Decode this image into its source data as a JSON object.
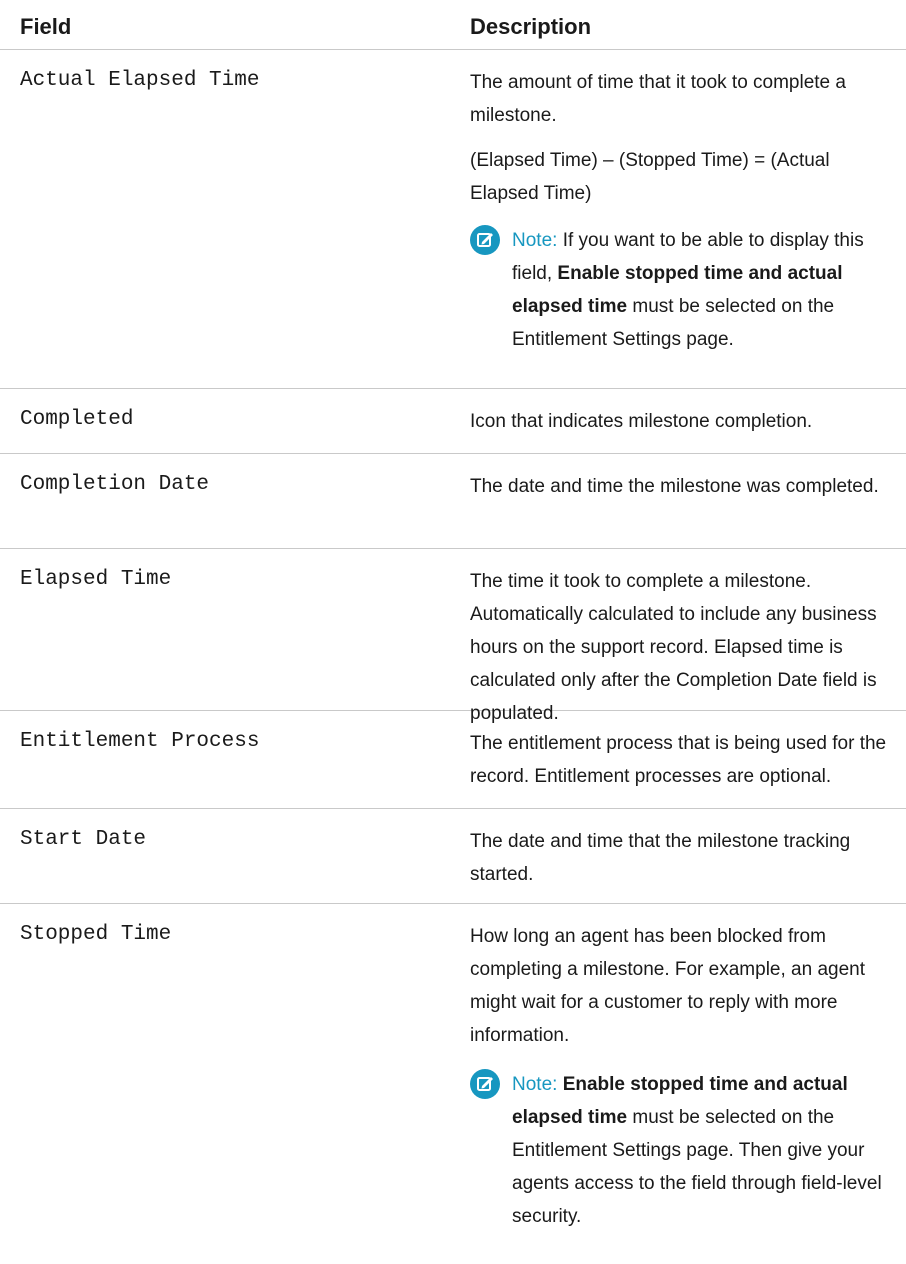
{
  "table": {
    "headers": {
      "field": "Field",
      "description": "Description"
    },
    "rows": [
      {
        "field": "Actual Elapsed Time",
        "desc1": "The amount of time that it took to complete a milestone.",
        "desc2": "(Elapsed Time) – (Stopped Time) = (Actual Elapsed Time)",
        "note": {
          "label": "Note:",
          "pre": " If you want to be able to display this field, ",
          "bold": "Enable stopped time and actual elapsed time",
          "post": " must be selected on the Entitlement Settings page."
        }
      },
      {
        "field": "Completed",
        "desc1": "Icon that indicates milestone completion."
      },
      {
        "field": "Completion Date",
        "desc1": "The date and time the milestone was completed."
      },
      {
        "field": "Elapsed Time",
        "desc1": "The time it took to complete a milestone. Automatically calculated to include any business hours on the support record. Elapsed time is calculated only after the Completion Date field is populated."
      },
      {
        "field": "Entitlement Process",
        "desc1": "The entitlement process that is being used for the record. Entitlement processes are optional."
      },
      {
        "field": "Start Date",
        "desc1": "The date and time that the milestone tracking started."
      },
      {
        "field": "Stopped Time",
        "desc1": "How long an agent has been blocked from completing a milestone. For example, an agent might wait for a customer to reply with more information.",
        "note": {
          "label": "Note:",
          "pre": " ",
          "bold": "Enable stopped time and actual elapsed time",
          "post": " must be selected on the Entitlement Settings page. Then give your agents access to the field through field-level security."
        }
      }
    ]
  },
  "icons": {
    "note": "note-edit-icon"
  },
  "colors": {
    "note_accent": "#1797c0",
    "rule": "#c9c9c9"
  }
}
